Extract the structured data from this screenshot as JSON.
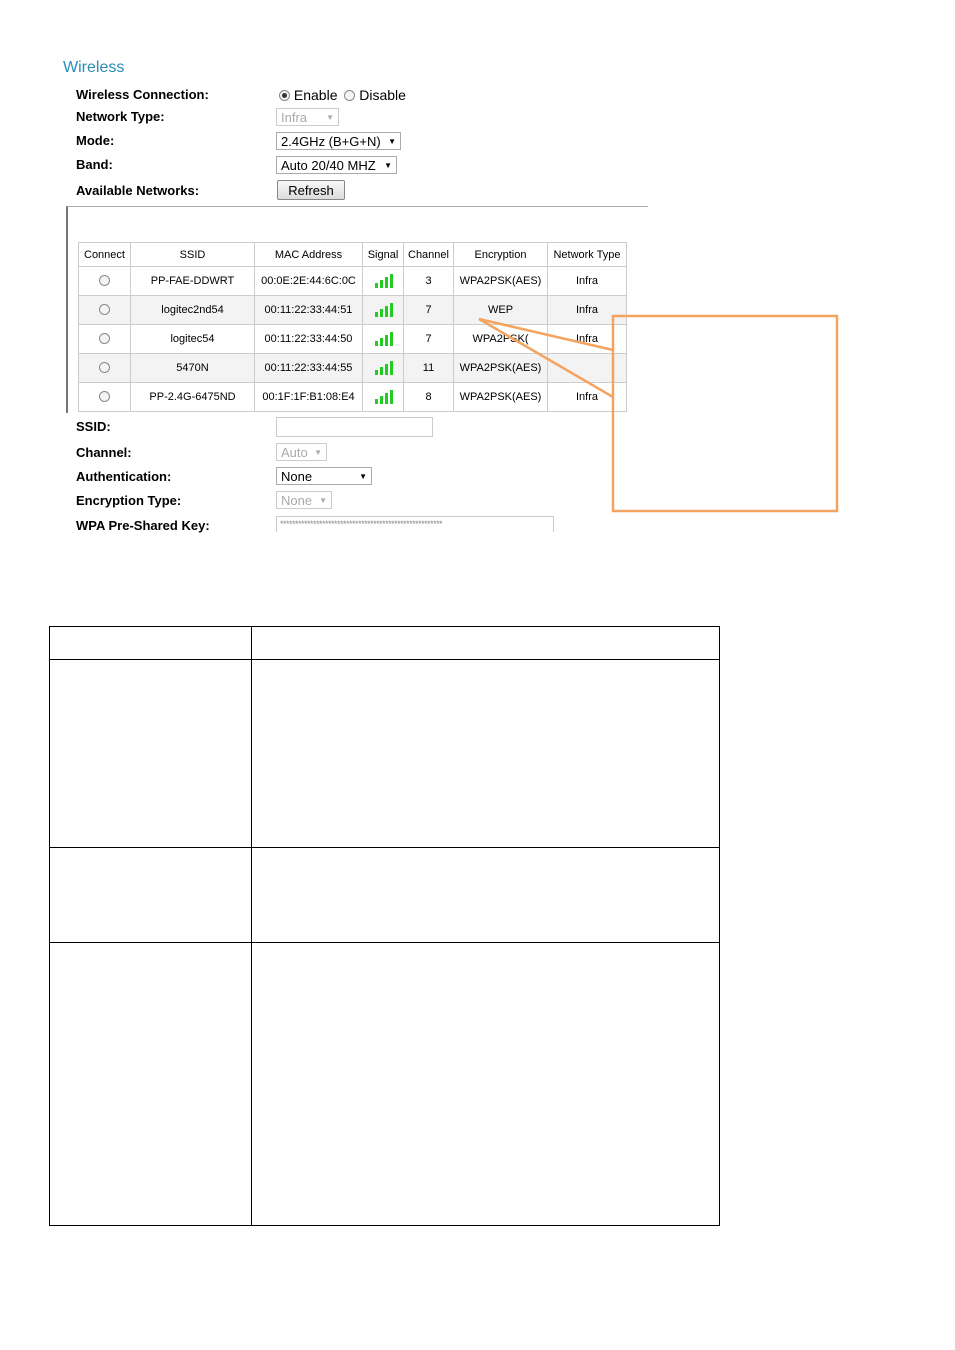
{
  "section_title": "Wireless",
  "labels": {
    "connection": "Wireless Connection:",
    "network_type": "Network Type:",
    "mode": "Mode:",
    "band": "Band:",
    "available": "Available Networks:",
    "ssid": "SSID:",
    "channel": "Channel:",
    "auth": "Authentication:",
    "enc_type": "Encryption Type:",
    "wpa_key": "WPA Pre-Shared Key:"
  },
  "connection": {
    "enable": "Enable",
    "disable": "Disable",
    "selected": "Enable"
  },
  "network_type": {
    "value": "Infra"
  },
  "mode": {
    "value": "2.4GHz (B+G+N)"
  },
  "band": {
    "value": "Auto 20/40 MHZ"
  },
  "refresh_label": "Refresh",
  "networks": {
    "columns": [
      "Connect",
      "SSID",
      "MAC Address",
      "Signal",
      "Channel",
      "Encryption",
      "Network Type"
    ],
    "rows": [
      {
        "ssid": "PP-FAE-DDWRT",
        "mac": "00:0E:2E:44:6C:0C",
        "signal": 4,
        "channel": "3",
        "encryption": "WPA2PSK(AES)",
        "type": "Infra"
      },
      {
        "ssid": "logitec2nd54",
        "mac": "00:11:22:33:44:51",
        "signal": 4,
        "channel": "7",
        "encryption": "WEP",
        "type": "Infra"
      },
      {
        "ssid": "logitec54",
        "mac": "00:11:22:33:44:50",
        "signal": 4,
        "channel": "7",
        "encryption": "WPA2PSK(",
        "type": "Infra"
      },
      {
        "ssid": "5470N",
        "mac": "00:11:22:33:44:55",
        "signal": 4,
        "channel": "11",
        "encryption": "WPA2PSK(AES)",
        "type": ""
      },
      {
        "ssid": "PP-2.4G-6475ND",
        "mac": "00:1F:1F:B1:08:E4",
        "signal": 4,
        "channel": "8",
        "encryption": "WPA2PSK(AES)",
        "type": "Infra"
      }
    ]
  },
  "ssid_value": "",
  "channel": {
    "value": "Auto"
  },
  "auth": {
    "value": "None"
  },
  "enc_type": {
    "value": "None"
  },
  "wpa_key_value": "******************************************************",
  "colors": {
    "title": "#2b8cb8",
    "callout": "#f4a460",
    "signal": "#22cc22"
  },
  "icons": [
    "radio-icon",
    "signal-bars-icon",
    "dropdown-arrow-icon"
  ]
}
